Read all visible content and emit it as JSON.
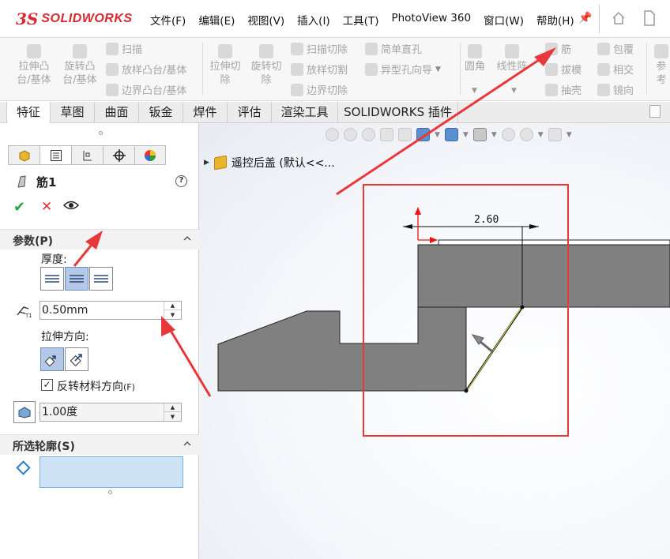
{
  "menubar": {
    "logo_mark": "3S",
    "logo_text": "SOLIDWORKS",
    "items": [
      "文件(F)",
      "编辑(E)",
      "视图(V)",
      "插入(I)",
      "工具(T)",
      "PhotoView 360",
      "窗口(W)",
      "帮助(H)"
    ],
    "pin_icon": "pin-icon",
    "home_icon": "home-icon",
    "doc_icon": "new-document-icon"
  },
  "ribbon": {
    "extrude_boss": "拉伸凸\n台/基体",
    "revolve_boss": "旋转凸\n台/基体",
    "sweep": "扫描",
    "loft_boss": "放样凸台/基体",
    "boundary_boss": "边界凸台/基体",
    "extrude_cut": "拉伸切\n除",
    "revolve_cut": "旋转切\n除",
    "sweep_cut": "扫描切除",
    "loft_cut": "放样切割",
    "boundary_cut": "边界切除",
    "simple_hole": "简单直孔",
    "hole_wizard": "异型孔向导",
    "fillet": "圆角",
    "linear_pattern": "线性阵",
    "rib": "筋",
    "draft": "拔模",
    "shell": "抽壳",
    "wrap": "包覆",
    "intersect": "相交",
    "mirror": "镜向",
    "reference": "参考"
  },
  "tabs": [
    {
      "label": "特征",
      "active": true
    },
    {
      "label": "草图",
      "active": false
    },
    {
      "label": "曲面",
      "active": false
    },
    {
      "label": "钣金",
      "active": false
    },
    {
      "label": "焊件",
      "active": false
    },
    {
      "label": "评估",
      "active": false
    },
    {
      "label": "渲染工具",
      "active": false
    },
    {
      "label": "SOLIDWORKS 插件",
      "active": false
    }
  ],
  "property_manager": {
    "feature_name": "筋1",
    "parameters": {
      "title": "参数(P)",
      "thickness_label": "厚度:",
      "thickness_value": "0.50mm",
      "direction_label": "拉伸方向:",
      "flip_material_label": "反转材料方向",
      "flip_material_suffix": "(F)",
      "flip_material_checked": true,
      "draft_value": "1.00度"
    },
    "selected_contours": {
      "title": "所选轮廓(S)"
    }
  },
  "viewport": {
    "tree_label": "遥控后盖  (默认<<...",
    "dimension": "2.60"
  },
  "colors": {
    "accent": "#d8282f",
    "annotation_red": "#e8383c",
    "part_fill": "#808080",
    "highlight_blue": "#cfe3f7"
  }
}
